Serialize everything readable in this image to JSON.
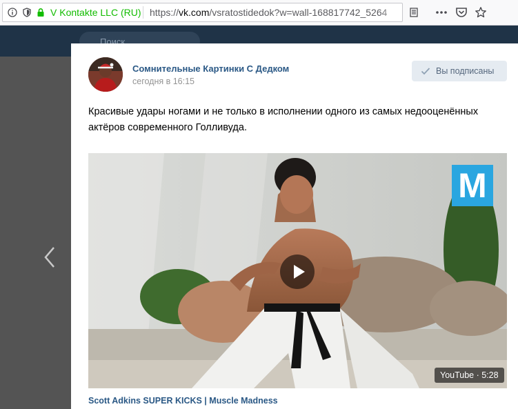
{
  "browser": {
    "site_identity": "V Kontakte LLC (RU)",
    "url_prefix": "https://",
    "url_domain": "vk.com",
    "url_path": "/vsratostidedok?w=wall-168817742_5264",
    "icons": [
      "info-icon",
      "shield-icon",
      "lock-icon",
      "reader-view-icon",
      "more-icon",
      "pocket-icon",
      "bookmark-star-icon"
    ]
  },
  "vk": {
    "search_placeholder": "Поиск"
  },
  "post": {
    "group_name": "Сомнительные Картинки С Дедком",
    "time": "сегодня в 16:15",
    "subscribe_label": "Вы подписаны",
    "text": "Красивые удары ногами и не только в исполнении одного из самых недооценённых актёров современного Голливуда.",
    "video": {
      "source": "YouTube",
      "duration": "5:28",
      "title": "Scott Adkins SUPER KICKS | Muscle Madness",
      "logo_letter": "M"
    }
  },
  "colors": {
    "vk_header": "#1f3347",
    "link_blue": "#2a5885",
    "secure_green": "#12bc00",
    "subscribe_bg": "#e5ebf1",
    "logo_blue": "#2aa6e0"
  }
}
